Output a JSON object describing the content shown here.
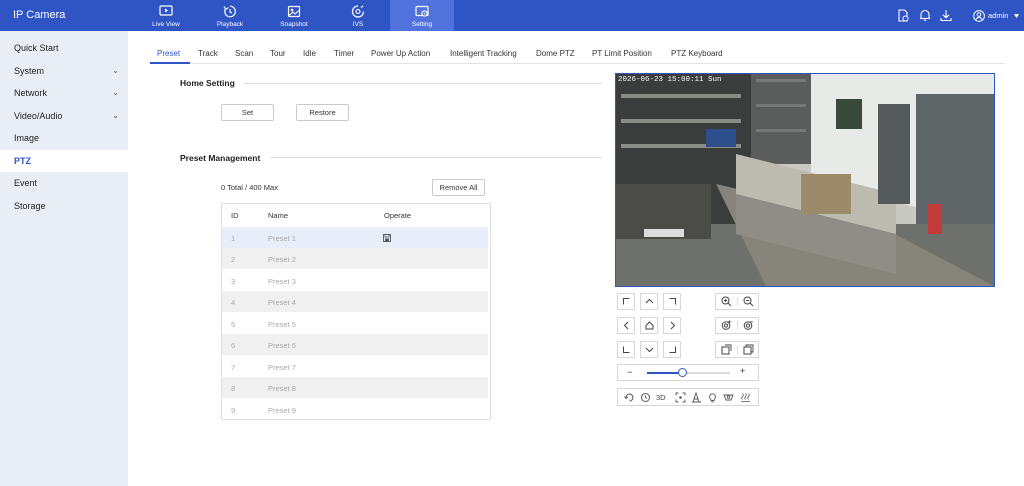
{
  "app": {
    "title": "IP Camera"
  },
  "topnav": [
    {
      "label": "Live View",
      "icon": "live-view-icon"
    },
    {
      "label": "Playback",
      "icon": "playback-icon"
    },
    {
      "label": "Snapshot",
      "icon": "snapshot-icon"
    },
    {
      "label": "IVS",
      "icon": "ivs-icon"
    },
    {
      "label": "Setting",
      "icon": "setting-icon",
      "active": true
    }
  ],
  "header_right": {
    "user": "admin"
  },
  "sidebar": {
    "items": [
      {
        "label": "Quick Start"
      },
      {
        "label": "System",
        "expandable": true
      },
      {
        "label": "Network",
        "expandable": true
      },
      {
        "label": "Video/Audio",
        "expandable": true
      },
      {
        "label": "Image"
      },
      {
        "label": "PTZ",
        "active": true
      },
      {
        "label": "Event"
      },
      {
        "label": "Storage"
      }
    ]
  },
  "tabs": [
    "Preset",
    "Track",
    "Scan",
    "Tour",
    "Idle",
    "Timer",
    "Power Up Action",
    "Intelligent Tracking",
    "Dome PTZ",
    "PT Limit Position",
    "PTZ Keyboard"
  ],
  "active_tab": "Preset",
  "home": {
    "title": "Home Setting",
    "set_label": "Set",
    "restore_label": "Restore"
  },
  "preset": {
    "title": "Preset Management",
    "total": "0 Total / 400 Max",
    "remove_all_label": "Remove All",
    "columns": {
      "id": "ID",
      "name": "Name",
      "operate": "Operate"
    },
    "rows": [
      {
        "id": "1",
        "name": "Preset 1"
      },
      {
        "id": "2",
        "name": "Preset 2"
      },
      {
        "id": "3",
        "name": "Preset 3"
      },
      {
        "id": "4",
        "name": "Preset 4"
      },
      {
        "id": "5",
        "name": "Preset 5"
      },
      {
        "id": "6",
        "name": "Preset 6"
      },
      {
        "id": "7",
        "name": "Preset 7"
      },
      {
        "id": "8",
        "name": "Preset 8"
      },
      {
        "id": "9",
        "name": "Preset 9"
      }
    ]
  },
  "camera": {
    "osd": "2026-06-23 15:00:11 Sun"
  },
  "ptz": {
    "speed_fraction": 0.42,
    "mode_3d": "3D"
  },
  "colors": {
    "brand": "#2f55c5",
    "sidebar": "#e9edf6",
    "nav_active": "#4f72dd"
  }
}
